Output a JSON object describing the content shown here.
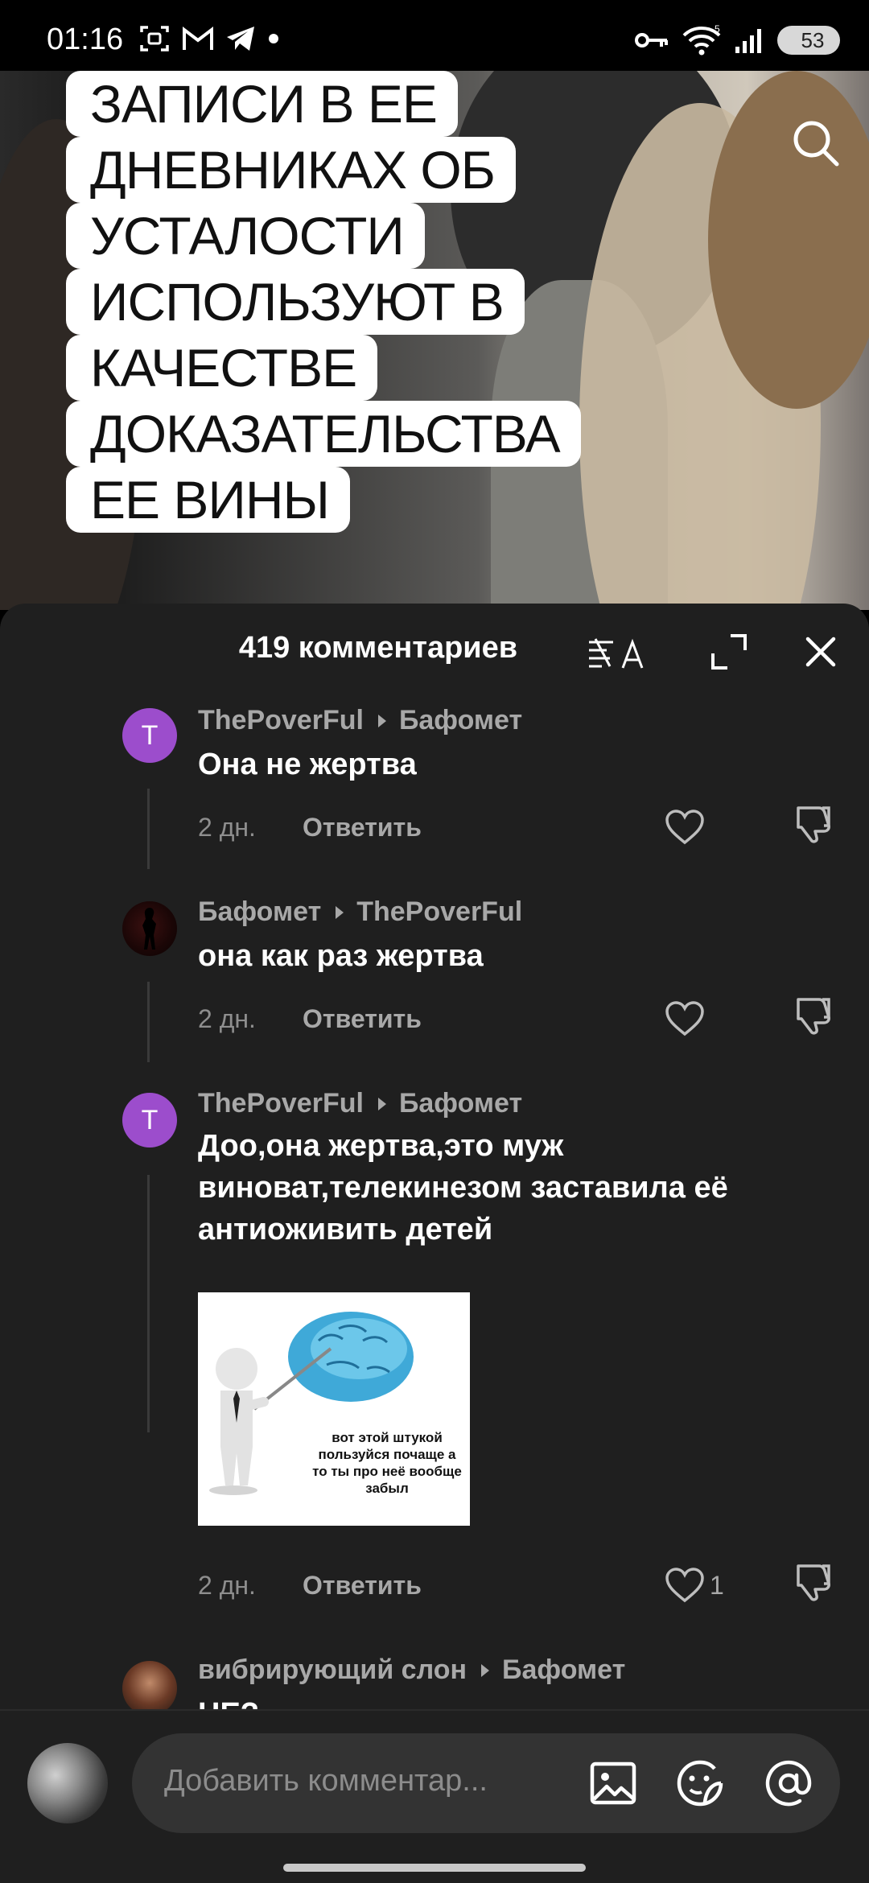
{
  "status_bar": {
    "time": "01:16",
    "battery": "53",
    "left_icons": [
      "screenshot-icon",
      "gmail-icon",
      "telegram-icon",
      "dot-icon"
    ],
    "right_icons": [
      "vpn-key-icon",
      "wifi-icon",
      "signal-icon",
      "battery-icon"
    ],
    "wifi_badge": "5"
  },
  "video": {
    "caption_lines": [
      "ЗАПИСИ В ЕЕ",
      "ДНЕВНИКАХ ОБ",
      "УСТАЛОСТИ",
      "ИСПОЛЬЗУЮТ В",
      "КАЧЕСТВЕ",
      "ДОКАЗАТЕЛЬСТВА",
      "ЕЕ ВИНЫ"
    ]
  },
  "comments_sheet": {
    "title": "419 комментариев",
    "translate_icon": "translate-icon",
    "expand_icon": "expand-icon",
    "close_icon": "close-icon"
  },
  "comments": [
    {
      "avatar_letter": "T",
      "author": "ThePoverFul",
      "reply_to": "Бафомет",
      "text": "Она не жертва",
      "time": "2 дн.",
      "reply_label": "Ответить",
      "likes": ""
    },
    {
      "avatar_letter": "",
      "author": "Бафомет",
      "reply_to": "ThePoverFul",
      "text": "она как раз жертва",
      "time": "2 дн.",
      "reply_label": "Ответить",
      "likes": ""
    },
    {
      "avatar_letter": "T",
      "author": "ThePoverFul",
      "reply_to": "Бафомет",
      "text": "Доо,она жертва,это муж виноват,телекинезом заставила её антиоживить детей",
      "meme_caption": "вот этой штукой пользуйся почаще а то ты про неё вообще забыл",
      "time": "2 дн.",
      "reply_label": "Ответить",
      "likes": "1"
    },
    {
      "avatar_letter": "",
      "author": "вибрирующий слон",
      "reply_to": "Бафомет",
      "text": "НЕ?"
    }
  ],
  "input": {
    "placeholder": "Добавить комментар..."
  },
  "colors": {
    "sheet_bg": "#1f1f1f",
    "avatar_purple": "#9c4dcc",
    "input_bg": "#333333"
  }
}
